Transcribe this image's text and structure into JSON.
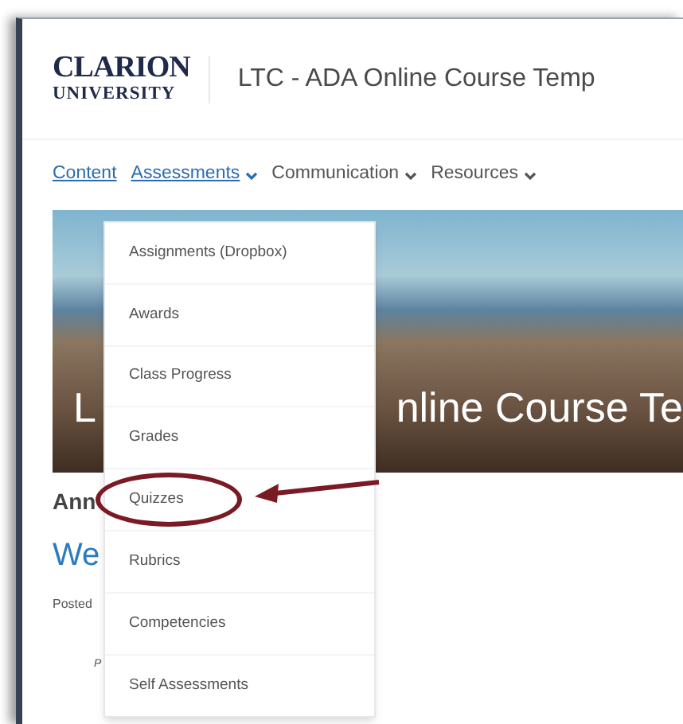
{
  "header": {
    "logo_line_1": "CLARION",
    "logo_line_2": "UNIVERSITY",
    "course_title": "LTC - ADA Online Course Temp"
  },
  "nav": [
    {
      "label": "Content",
      "kind": "link"
    },
    {
      "label": "Assessments",
      "kind": "dropdown",
      "expanded": true
    },
    {
      "label": "Communication",
      "kind": "dropdown",
      "expanded": false
    },
    {
      "label": "Resources",
      "kind": "dropdown",
      "expanded": false
    }
  ],
  "banner": {
    "title_left": "L",
    "title_right": "nline Course Te"
  },
  "content": {
    "heading": "Ann",
    "post_title": "We",
    "posted": "Posted",
    "body": "P"
  },
  "menu": [
    {
      "label": "Assignments (Dropbox)",
      "annotated": false
    },
    {
      "label": "Awards",
      "annotated": false
    },
    {
      "label": "Class Progress",
      "annotated": false
    },
    {
      "label": "Grades",
      "annotated": false
    },
    {
      "label": "Quizzes",
      "annotated": true
    },
    {
      "label": "Rubrics",
      "annotated": false
    },
    {
      "label": "Competencies",
      "annotated": false
    },
    {
      "label": "Self Assessments",
      "annotated": false
    }
  ]
}
